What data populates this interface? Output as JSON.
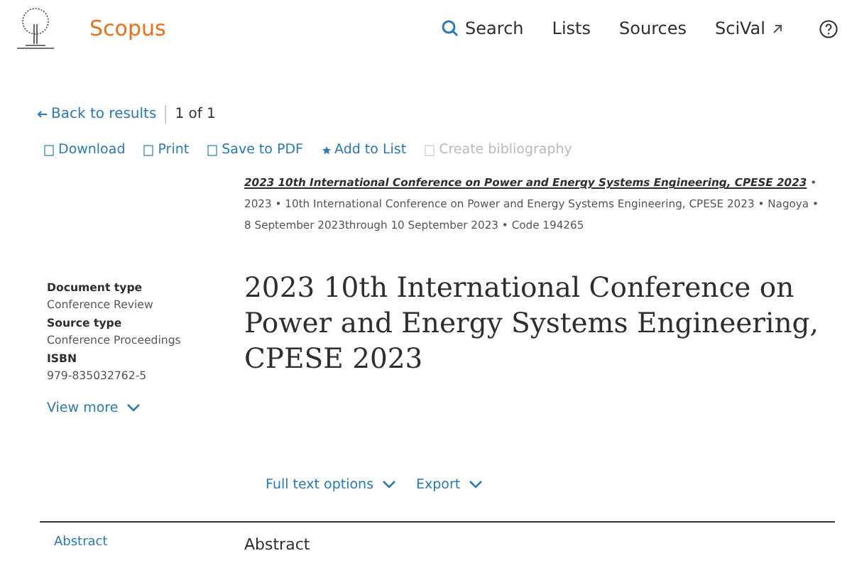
{
  "header": {
    "brand": "Scopus",
    "nav": [
      {
        "label": "Search",
        "kind": "search"
      },
      {
        "label": "Lists",
        "kind": "plain"
      },
      {
        "label": "Sources",
        "kind": "plain"
      },
      {
        "label": "SciVal",
        "kind": "external"
      }
    ]
  },
  "pager": {
    "back": "Back to results",
    "position": "1 of 1"
  },
  "actions": [
    {
      "label": "Download",
      "kind": "box",
      "disabled": false
    },
    {
      "label": "Print",
      "kind": "box",
      "disabled": false
    },
    {
      "label": "Save to PDF",
      "kind": "box",
      "disabled": false
    },
    {
      "label": "Add to List",
      "kind": "star",
      "disabled": false
    },
    {
      "label": "Create bibliography",
      "kind": "box",
      "disabled": true
    }
  ],
  "source": {
    "separator": "•",
    "link": "2023 10th International Conference on Power and Energy Systems Engineering, CPESE 2023",
    "details": [
      "2023",
      "10th International Conference on Power and Energy Systems Engineering, CPESE 2023",
      "Nagoya",
      "8 September 2023through 10 September 2023",
      "Code 194265"
    ]
  },
  "meta": [
    {
      "label": "Document type",
      "value": "Conference Review"
    },
    {
      "label": "Source type",
      "value": "Conference Proceedings"
    },
    {
      "label": "ISBN",
      "value": "979-835032762-5"
    }
  ],
  "view_more": "View more",
  "title": "2023 10th International Conference on Power and Energy Systems Engineering, CPESE 2023",
  "options": [
    "Full text options",
    "Export"
  ],
  "section_nav": "Abstract",
  "section_title": "Abstract"
}
